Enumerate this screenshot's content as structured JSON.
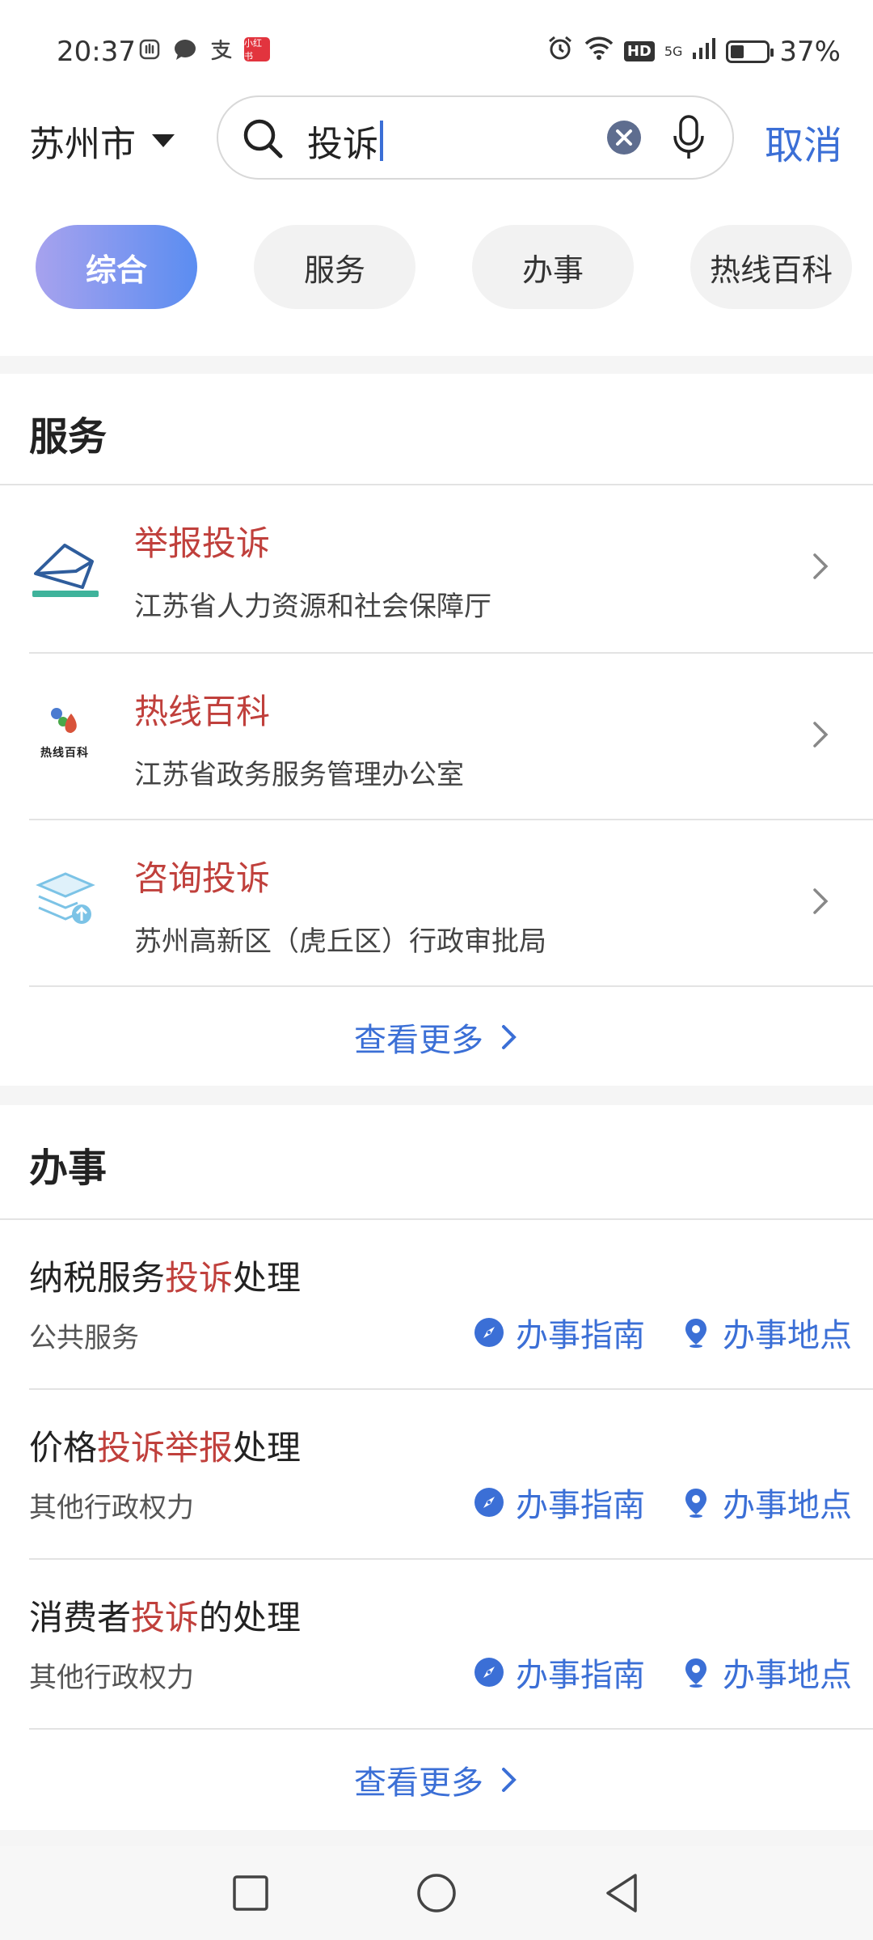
{
  "status_bar": {
    "time": "20:37",
    "app_badge": "小红书",
    "network": "5G",
    "hd": "HD",
    "battery": "37%",
    "battery_level": 0.37,
    "icons": [
      "hand-icon",
      "chat-icon",
      "alipay-icon",
      "alarm-icon",
      "wifi-icon",
      "signal-icon"
    ]
  },
  "header": {
    "city": "苏州市",
    "search_value": "投诉",
    "cancel_label": "取消"
  },
  "tabs": [
    {
      "label": "综合",
      "active": true
    },
    {
      "label": "服务",
      "active": false
    },
    {
      "label": "办事",
      "active": false
    },
    {
      "label": "热线百科",
      "active": false
    }
  ],
  "services": {
    "title": "服务",
    "items": [
      {
        "name": "举报投诉",
        "dept": "江苏省人力资源和社会保障厅",
        "icon": "envelope-icon"
      },
      {
        "name": "热线百科",
        "dept": "江苏省政务服务管理办公室",
        "icon": "hotline-logo-icon",
        "logo_text": "热线百科"
      },
      {
        "name": "咨询投诉",
        "dept": "苏州高新区（虎丘区）行政审批局",
        "icon": "layers-icon"
      }
    ],
    "more_label": "查看更多"
  },
  "tasks": {
    "title": "办事",
    "items": [
      {
        "parts": [
          {
            "t": "纳税服务",
            "hl": false
          },
          {
            "t": "投诉",
            "hl": true
          },
          {
            "t": "处理",
            "hl": false
          }
        ],
        "category": "公共服务"
      },
      {
        "parts": [
          {
            "t": "价格",
            "hl": false
          },
          {
            "t": "投诉举报",
            "hl": true
          },
          {
            "t": "处理",
            "hl": false
          }
        ],
        "category": "其他行政权力"
      },
      {
        "parts": [
          {
            "t": "消费者",
            "hl": false
          },
          {
            "t": "投诉",
            "hl": true
          },
          {
            "t": "的处理",
            "hl": false
          }
        ],
        "category": "其他行政权力"
      }
    ],
    "guide_label": "办事指南",
    "location_label": "办事地点",
    "more_label": "查看更多"
  },
  "colors": {
    "accent": "#3b6fd6",
    "highlight": "#c0403c"
  }
}
